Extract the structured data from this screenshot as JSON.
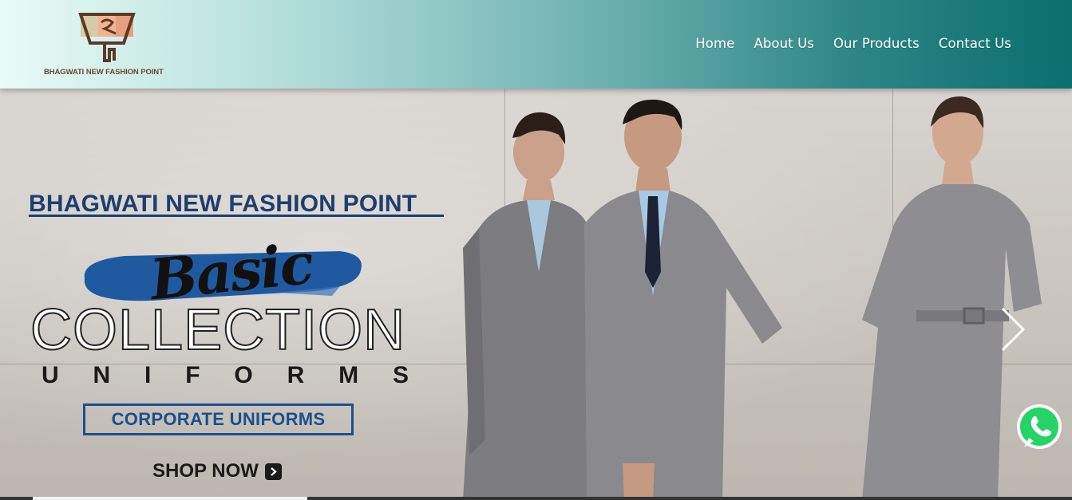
{
  "header": {
    "logo_text": "BHAGWATI NEW FASHION POINT",
    "nav": [
      {
        "label": "Home"
      },
      {
        "label": "About Us"
      },
      {
        "label": "Our Products"
      },
      {
        "label": "Contact Us"
      }
    ]
  },
  "hero": {
    "brand_title": "BHAGWATI NEW FASHION POINT",
    "script_word": "Basic",
    "headline": "COLLECTION",
    "subline_letters": [
      "U",
      "N",
      "I",
      "F",
      "O",
      "R",
      "M",
      "S"
    ],
    "category": "CORPORATE UNIFORMS",
    "cta": "SHOP NOW",
    "colors": {
      "brand_navy": "#1d3f6e",
      "brush_blue": "#1f5aa0",
      "header_teal": "#0b6e6e"
    }
  },
  "icons": {
    "next": "chevron-right-icon",
    "whatsapp": "whatsapp-icon",
    "shop_arrow": "arrow-right-box-icon"
  }
}
